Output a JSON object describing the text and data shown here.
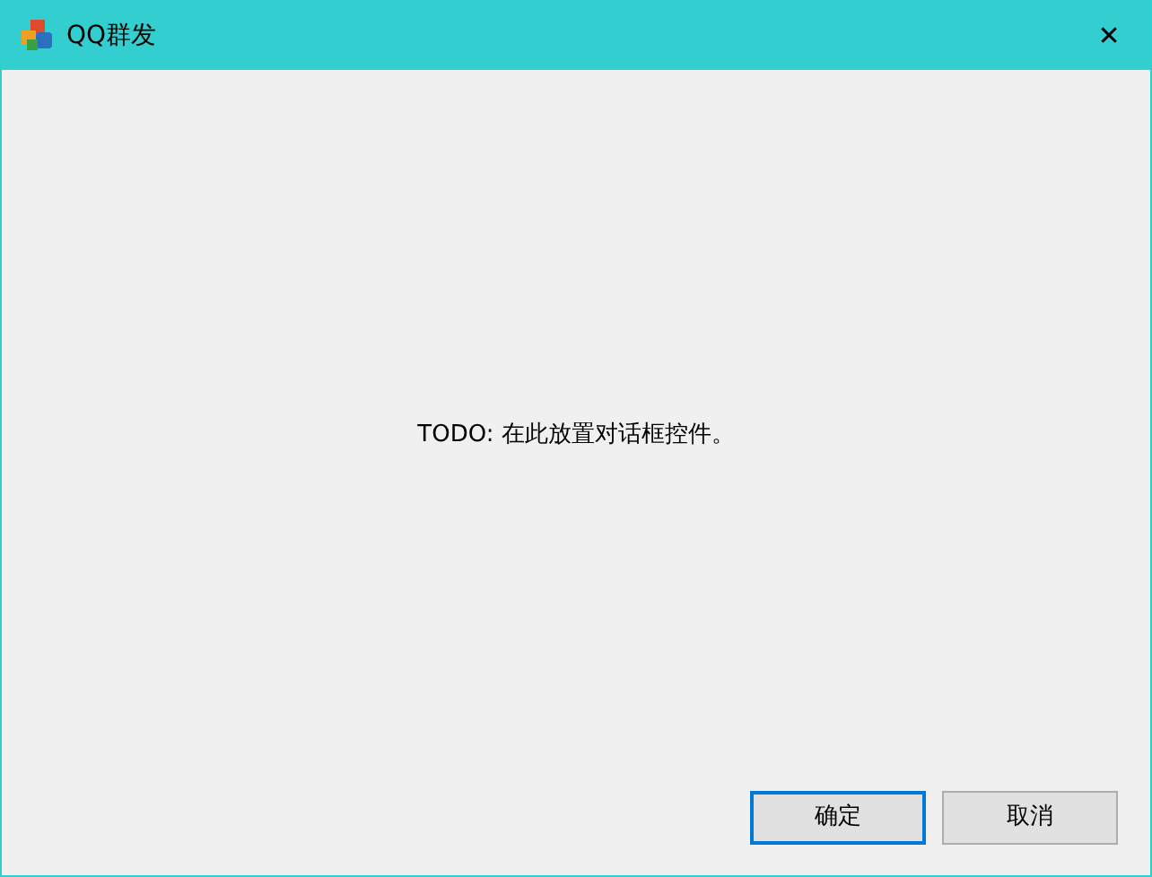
{
  "window": {
    "title": "QQ群发",
    "close": "✕"
  },
  "message": "TODO: 在此放置对话框控件。",
  "buttons": [
    {
      "label": "确定",
      "default": true
    },
    {
      "label": "取消",
      "default": false
    }
  ]
}
